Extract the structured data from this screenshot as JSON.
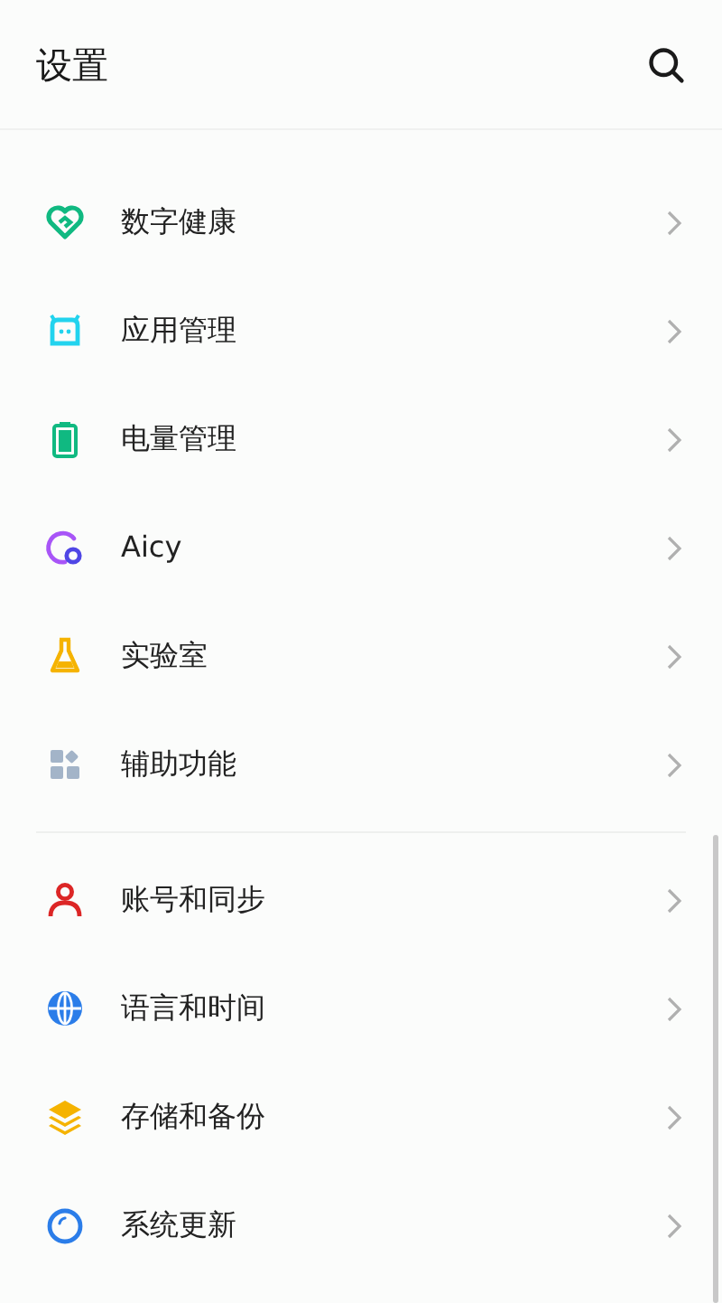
{
  "header": {
    "title": "设置"
  },
  "sections": [
    {
      "items": [
        {
          "label": "数字健康"
        },
        {
          "label": "应用管理"
        },
        {
          "label": "电量管理"
        },
        {
          "label": "Aicy"
        },
        {
          "label": "实验室"
        },
        {
          "label": "辅助功能"
        }
      ]
    },
    {
      "items": [
        {
          "label": "账号和同步"
        },
        {
          "label": "语言和时间"
        },
        {
          "label": "存储和备份"
        },
        {
          "label": "系统更新"
        }
      ]
    }
  ]
}
